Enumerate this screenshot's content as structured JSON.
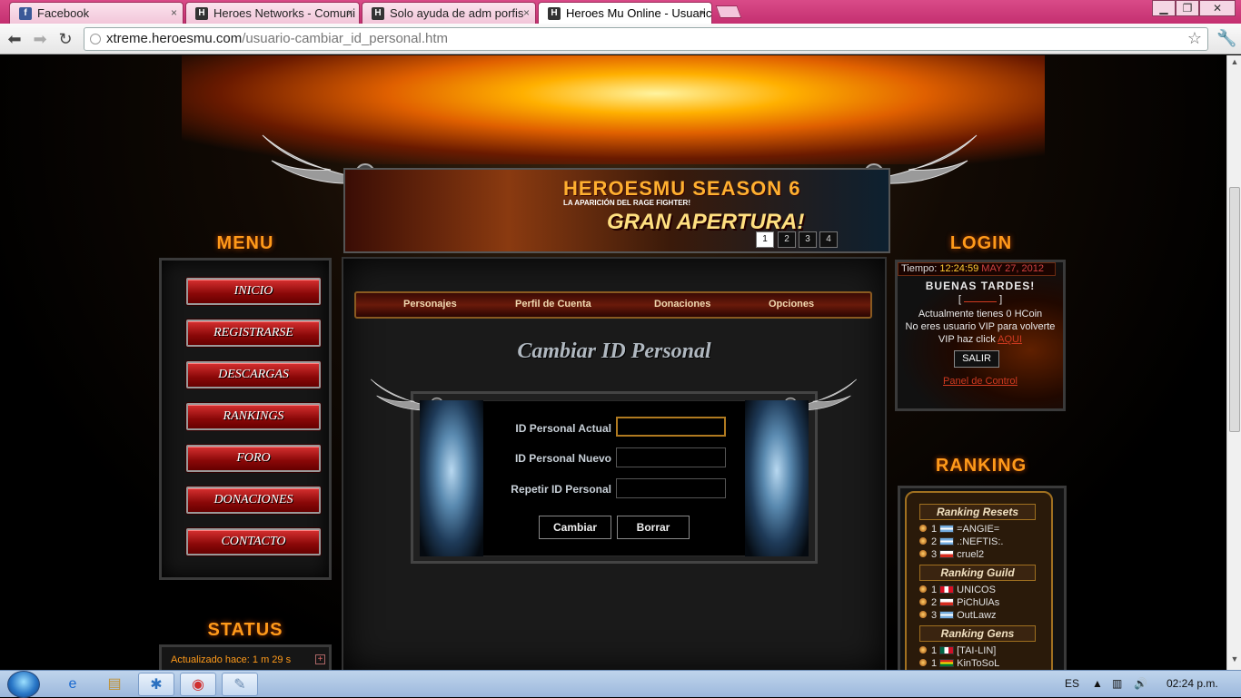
{
  "browser": {
    "tabs": [
      {
        "label": "Facebook",
        "favicon": "f"
      },
      {
        "label": "Heroes Networks - Comuni",
        "favicon": "H"
      },
      {
        "label": "Solo ayuda de adm porfis",
        "favicon": "H"
      },
      {
        "label": "Heroes Mu Online - Usuaric",
        "favicon": "H"
      }
    ],
    "tab_close": "×",
    "url_host": "xtreme.heroesmu.com",
    "url_path": "/usuario-cambiar_id_personal.htm",
    "colors": {
      "tabbar": "#c42f70"
    }
  },
  "site": {
    "menu_title": "MENU",
    "login_title": "LOGIN",
    "ranking_title": "RANKING",
    "status_title": "STATUS",
    "banner": {
      "title": "HEROESMU SEASON 6",
      "subtitle": "LA APARICIÓN DEL RAGE FIGHTER!",
      "headline": "GRAN APERTURA!",
      "pages": [
        "1",
        "2",
        "3",
        "4"
      ]
    },
    "menu": [
      "INICIO",
      "REGISTRARSE",
      "DESCARGAS",
      "RANKINGS",
      "FORO",
      "DONACIONES",
      "CONTACTO"
    ],
    "status_text": "Actualizado hace: 1 m 29 s",
    "status_plus": "+",
    "topnav": [
      "Personajes",
      "Perfil de Cuenta",
      "Donaciones",
      "Opciones"
    ],
    "page_title": "Cambiar ID Personal",
    "form": {
      "fields": [
        {
          "label": "ID Personal Actual",
          "value": ""
        },
        {
          "label": "ID Personal Nuevo",
          "value": ""
        },
        {
          "label": "Repetir ID Personal",
          "value": ""
        }
      ],
      "submit": "Cambiar",
      "reset": "Borrar"
    },
    "login": {
      "time_label": "Tiempo:",
      "time_value": "12:24:59",
      "date_value": "MAY 27, 2012",
      "greeting": "BUENAS TARDES!",
      "user_bracket_left": "[",
      "user_bracket_right": "]",
      "hcoin": "Actualmente tienes 0 HCoin",
      "vip_line1": "No eres usuario VIP para volverte",
      "vip_line2": "VIP haz click",
      "vip_link": "AQUI",
      "logout": "SALIR",
      "panel_link": "Panel de Control"
    },
    "ranking": {
      "resets_title": "Ranking Resets",
      "resets": [
        {
          "pos": "1",
          "name": "=ANGIE=",
          "flag": "ar"
        },
        {
          "pos": "2",
          "name": ".:NEFTIS:.",
          "flag": "ar"
        },
        {
          "pos": "3",
          "name": "cruel2",
          "flag": "cl"
        }
      ],
      "guild_title": "Ranking Guild",
      "guild": [
        {
          "pos": "1",
          "name": "UNICOS",
          "flag": "pe"
        },
        {
          "pos": "2",
          "name": "PiChUlAs",
          "flag": "cl"
        },
        {
          "pos": "3",
          "name": "OutLawz",
          "flag": "ar"
        }
      ],
      "gens_title": "Ranking Gens",
      "gens": [
        {
          "pos": "1",
          "name": "[TAI-LIN]",
          "flag": "mx"
        },
        {
          "pos": "1",
          "name": "KinToSoL",
          "flag": "bo"
        }
      ]
    }
  },
  "taskbar": {
    "lang": "ES",
    "clock": "02:24 p.m."
  }
}
